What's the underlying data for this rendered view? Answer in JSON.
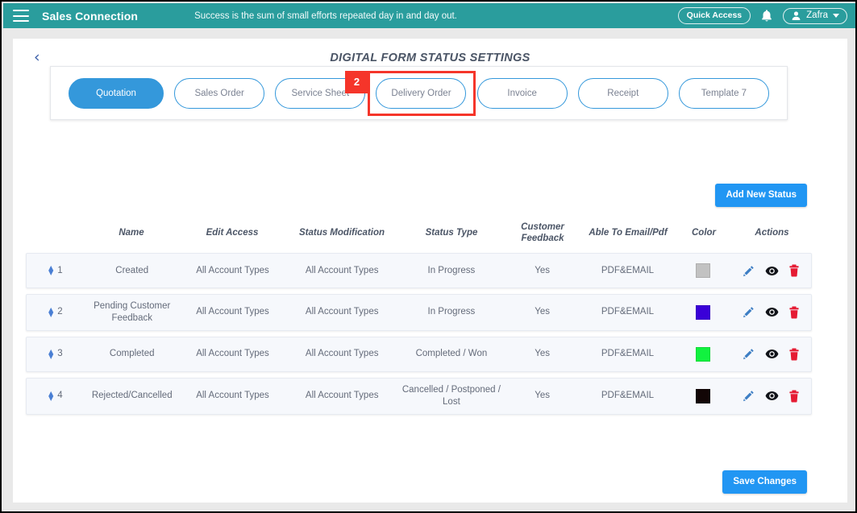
{
  "appbar": {
    "menu_icon": "hamburger-icon",
    "brand": "Sales Connection",
    "tagline": "Success is the sum of small efforts repeated day in and day out.",
    "quick_access_label": "Quick Access",
    "notification_icon": "bell-icon",
    "user_name": "Zafra",
    "user_icon": "user-icon",
    "caret_icon": "chevron-down-icon",
    "bar_color": "#2a9d9d"
  },
  "page": {
    "back_icon": "chevron-left-icon",
    "title": "DIGITAL FORM STATUS SETTINGS"
  },
  "tabs": [
    {
      "label": "Quotation",
      "active": true
    },
    {
      "label": "Sales Order",
      "active": false
    },
    {
      "label": "Service Sheet",
      "active": false
    },
    {
      "label": "Delivery Order",
      "active": false
    },
    {
      "label": "Invoice",
      "active": false
    },
    {
      "label": "Receipt",
      "active": false
    },
    {
      "label": "Template 7",
      "active": false
    }
  ],
  "highlight": {
    "badge_number": "2",
    "target_tab": "Delivery Order",
    "color": "#f5352a"
  },
  "toolbar": {
    "add_new_status_label": "Add New Status",
    "save_changes_label": "Save Changes",
    "button_color": "#2196f3"
  },
  "table": {
    "headers": {
      "index": "",
      "name": "Name",
      "edit_access": "Edit Access",
      "status_modification": "Status Modification",
      "status_type": "Status Type",
      "customer_feedback": "Customer Feedback",
      "able_to_email_pdf": "Able To Email/Pdf",
      "color": "Color",
      "actions": "Actions"
    },
    "rows": [
      {
        "index": "1",
        "name": "Created",
        "edit_access": "All Account Types",
        "status_modification": "All Account Types",
        "status_type": "In Progress",
        "customer_feedback": "Yes",
        "able_to_email_pdf": "PDF&EMAIL",
        "color": "#c2c2c2"
      },
      {
        "index": "2",
        "name": "Pending Customer Feedback",
        "edit_access": "All Account Types",
        "status_modification": "All Account Types",
        "status_type": "In Progress",
        "customer_feedback": "Yes",
        "able_to_email_pdf": "PDF&EMAIL",
        "color": "#3a00d8"
      },
      {
        "index": "3",
        "name": "Completed",
        "edit_access": "All Account Types",
        "status_modification": "All Account Types",
        "status_type": "Completed / Won",
        "customer_feedback": "Yes",
        "able_to_email_pdf": "PDF&EMAIL",
        "color": "#11f23f"
      },
      {
        "index": "4",
        "name": "Rejected/Cancelled",
        "edit_access": "All Account Types",
        "status_modification": "All Account Types",
        "status_type": "Cancelled / Postponed / Lost",
        "customer_feedback": "Yes",
        "able_to_email_pdf": "PDF&EMAIL",
        "color": "#120606"
      }
    ],
    "action_icons": {
      "edit": "pencil-icon",
      "view": "eye-icon",
      "delete": "trash-icon"
    },
    "sort_icon": "sort-updown-icon"
  }
}
